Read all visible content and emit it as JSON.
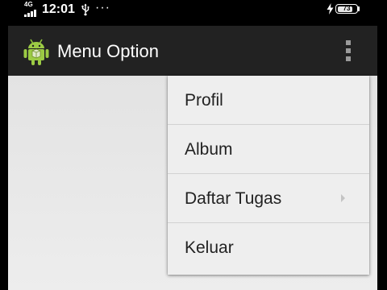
{
  "status_bar": {
    "network": "4G",
    "time": "12:01",
    "overflow": "···",
    "battery_level": "73",
    "usb_icon": "usb-icon",
    "charging_icon": "bolt-icon"
  },
  "action_bar": {
    "title": "Menu Option",
    "app_icon": "android-icon",
    "overflow_icon": "more-vert-icon",
    "background": "#222222"
  },
  "menu": {
    "items": [
      {
        "label": "Profil"
      },
      {
        "label": "Album"
      },
      {
        "label": "Daftar Tugas",
        "has_submenu": true
      },
      {
        "label": "Keluar"
      }
    ]
  }
}
